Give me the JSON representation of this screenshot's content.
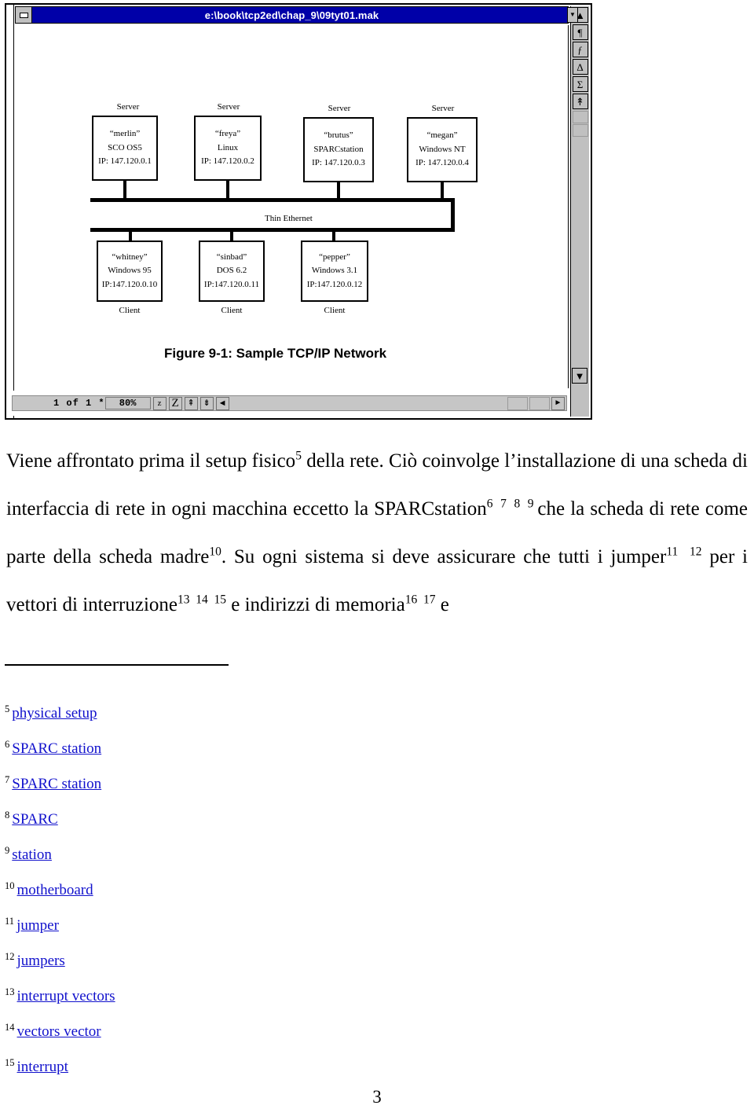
{
  "window": {
    "title": "e:\\book\\tcp2ed\\chap_9\\09tyt01.mak",
    "minimize_glyph": "▬",
    "titlebar_dropdown_glyph": "▼",
    "colors": {
      "titlebar": "#0000a8",
      "chrome": "#c0c0c0",
      "link": "#1111cc"
    },
    "right_toolbar": [
      {
        "name": "scroll-up-button",
        "glyph": "▲"
      },
      {
        "name": "pilcrow-button",
        "glyph": "¶"
      },
      {
        "name": "function-button",
        "glyph": "ƒ"
      },
      {
        "name": "delta-button",
        "glyph": "Δ"
      },
      {
        "name": "sigma-button",
        "glyph": "Σ"
      },
      {
        "name": "up-arrow-button",
        "glyph": "↟"
      }
    ],
    "statusbar": {
      "pages": "1 of 1 *",
      "zoom": "80%",
      "buttons": [
        {
          "name": "zoom-out-button",
          "glyph": "z"
        },
        {
          "name": "zoom-in-button",
          "glyph": "Z"
        },
        {
          "name": "page-up-button",
          "glyph": "⇞"
        },
        {
          "name": "page-down-button",
          "glyph": "⇟"
        },
        {
          "name": "scroll-left-button",
          "glyph": "◄"
        }
      ],
      "scroll_right_glyph": "►",
      "scroll_down_glyph": "▼"
    }
  },
  "figure": {
    "caption": "Figure 9-1: Sample TCP/IP Network",
    "bus_label": "Thin Ethernet",
    "servers": [
      {
        "role": "Server",
        "name": "“merlin”",
        "os": "SCO OS5",
        "ip": "IP:  147.120.0.1"
      },
      {
        "role": "Server",
        "name": "“freya”",
        "os": "Linux",
        "ip": "IP:  147.120.0.2"
      },
      {
        "role": "Server",
        "name": "“brutus”",
        "os": "SPARCstation",
        "ip": "IP:  147.120.0.3"
      },
      {
        "role": "Server",
        "name": "“megan”",
        "os": "Windows NT",
        "ip": "IP:  147.120.0.4"
      }
    ],
    "clients": [
      {
        "role": "Client",
        "name": "“whitney”",
        "os": "Windows 95",
        "ip": "IP:147.120.0.10"
      },
      {
        "role": "Client",
        "name": "“sinbad”",
        "os": "DOS 6.2",
        "ip": "IP:147.120.0.11"
      },
      {
        "role": "Client",
        "name": "“pepper”",
        "os": "Windows 3.1",
        "ip": "IP:147.120.0.12"
      }
    ]
  },
  "body": {
    "paragraph_html": "Viene affrontato prima il setup fisico<sup>5</sup> della rete. Ciò coinvolge l’installazione di una scheda di interfaccia di rete in ogni macchina eccetto la SPARCstation<sup>6&nbsp; 7&nbsp; 8&nbsp; 9&nbsp;</sup>che la scheda di rete come parte della scheda madre<sup>10</sup>. Su ogni sistema si deve assicurare che tutti i jumper<sup>11&nbsp; 12</sup> per i vettori di interruzione<sup>13&nbsp; 14&nbsp; 15</sup> e indirizzi di memoria<sup>16&nbsp; 17</sup> e"
  },
  "footnotes": [
    {
      "marker": "5",
      "text": "physical setup"
    },
    {
      "marker": "6",
      "text": "SPARC station"
    },
    {
      "marker": "7",
      "text": "SPARC station"
    },
    {
      "marker": "8",
      "text": "SPARC"
    },
    {
      "marker": "9",
      "text": "station"
    },
    {
      "marker": "10",
      "text": "motherboard"
    },
    {
      "marker": "11",
      "text": "jumper"
    },
    {
      "marker": "12",
      "text": "jumpers"
    },
    {
      "marker": "13",
      "text": "interrupt vectors"
    },
    {
      "marker": "14",
      "text": "vectors vector"
    },
    {
      "marker": "15",
      "text": "interrupt"
    }
  ],
  "page_number": "3"
}
